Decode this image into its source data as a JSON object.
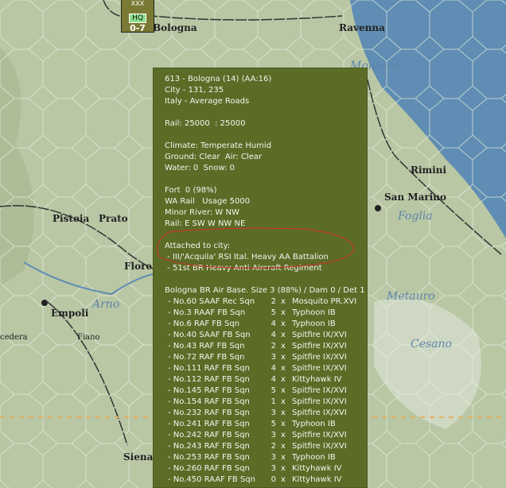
{
  "map": {
    "cities": [
      "Bologna",
      "Ravenna",
      "Rimini",
      "San Marino",
      "Pistoia",
      "Prato",
      "Flore",
      "Empoli",
      "Fiano",
      "cedera",
      "Siena"
    ],
    "rivers": [
      "Montone",
      "Foglia",
      "Arno",
      "Metauro",
      "Cesano"
    ],
    "colors": {
      "land": "#b9c7a5",
      "sea": "#5f8db3",
      "tooltip": "#5b6c27",
      "highlight": "#c0392b"
    }
  },
  "unit_counter": {
    "size": "XXX",
    "type": "HQ",
    "strength": "0-7"
  },
  "tooltip": {
    "lines": [
      "613 - Bologna (14) (AA:16)",
      "City - 131, 235",
      "Italy - Average Roads",
      "",
      "Rail: 25000  : 25000",
      "",
      "Climate: Temperate Humid",
      "Ground: Clear  Air: Clear",
      "Water: 0  Snow: 0",
      "",
      "Fort  0 (98%)",
      "WA Rail   Usage 5000",
      "Minor River: W NW",
      "Rail: E SW W NW NE",
      "",
      "Attached to city:",
      " - III/'Acquila' RSI Ital. Heavy AA Battalion",
      " - 51st BR Heavy Anti-Aircraft Regiment",
      "",
      "Bologna BR Air Base. Size 3 (88%) / Dam 0 / Det 1"
    ],
    "squadrons": [
      {
        "name": "- No.60 SAAF Rec Sqn",
        "count": "2",
        "aircraft": "Mosquito PR.XVI"
      },
      {
        "name": "- No.3 RAAF FB Sqn",
        "count": "5",
        "aircraft": "Typhoon IB"
      },
      {
        "name": "- No.6 RAF FB Sqn",
        "count": "4",
        "aircraft": "Typhoon IB"
      },
      {
        "name": "- No.40 SAAF FB Sqn",
        "count": "4",
        "aircraft": "Spitfire IX/XVI"
      },
      {
        "name": "- No.43 RAF FB Sqn",
        "count": "2",
        "aircraft": "Spitfire IX/XVI"
      },
      {
        "name": "- No.72 RAF FB Sqn",
        "count": "3",
        "aircraft": "Spitfire IX/XVI"
      },
      {
        "name": "- No.111 RAF FB Sqn",
        "count": "4",
        "aircraft": "Spitfire IX/XVI"
      },
      {
        "name": "- No.112 RAF FB Sqn",
        "count": "4",
        "aircraft": "Kittyhawk IV"
      },
      {
        "name": "- No.145 RAF FB Sqn",
        "count": "5",
        "aircraft": "Spitfire IX/XVI"
      },
      {
        "name": "- No.154 RAF FB Sqn",
        "count": "1",
        "aircraft": "Spitfire IX/XVI"
      },
      {
        "name": "- No.232 RAF FB Sqn",
        "count": "3",
        "aircraft": "Spitfire IX/XVI"
      },
      {
        "name": "- No.241 RAF FB Sqn",
        "count": "5",
        "aircraft": "Typhoon IB"
      },
      {
        "name": "- No.242 RAF FB Sqn",
        "count": "3",
        "aircraft": "Spitfire IX/XVI"
      },
      {
        "name": "- No.243 RAF FB Sqn",
        "count": "2",
        "aircraft": "Spitfire IX/XVI"
      },
      {
        "name": "- No.253 RAF FB Sqn",
        "count": "3",
        "aircraft": "Typhoon IB"
      },
      {
        "name": "- No.260 RAF FB Sqn",
        "count": "3",
        "aircraft": "Kittyhawk IV"
      },
      {
        "name": "- No.450 RAAF FB Sqn",
        "count": "0",
        "aircraft": "Kittyhawk IV"
      }
    ],
    "times": "x"
  }
}
